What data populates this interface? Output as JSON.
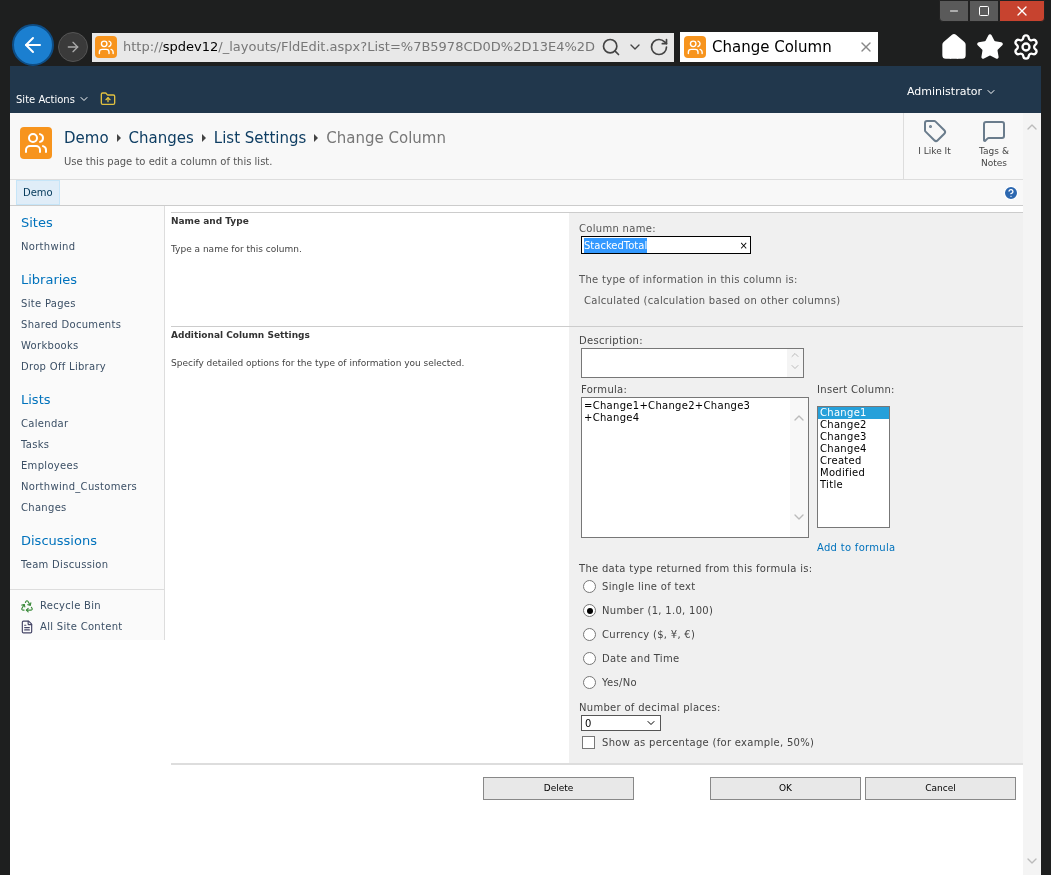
{
  "browser": {
    "url_host": "spdev12",
    "url_prefix": "http://",
    "url_rest": "/_layouts/FldEdit.aspx?List=%7B5978CD0D%2D13E4%2D",
    "tab_title": "Change Column"
  },
  "ribbon": {
    "site_actions": "Site Actions",
    "user": "Administrator"
  },
  "header": {
    "breadcrumb": [
      "Demo",
      "Changes",
      "List Settings",
      "Change Column"
    ],
    "description": "Use this page to edit a column of this list.",
    "actions": [
      {
        "label": "I Like It",
        "kind": "like"
      },
      {
        "label": "Tags & Notes",
        "kind": "tags"
      }
    ]
  },
  "top_nav": [
    {
      "label": "Demo",
      "selected": true
    }
  ],
  "sidebar": {
    "sections": [
      {
        "heading": "Sites",
        "items": [
          "Northwind"
        ]
      },
      {
        "heading": "Libraries",
        "items": [
          "Site Pages",
          "Shared Documents",
          "Workbooks",
          "Drop Off Library"
        ]
      },
      {
        "heading": "Lists",
        "items": [
          "Calendar",
          "Tasks",
          "Employees",
          "Northwind_Customers",
          "Changes"
        ]
      },
      {
        "heading": "Discussions",
        "items": [
          "Team Discussion"
        ]
      }
    ],
    "footer": [
      {
        "label": "Recycle Bin",
        "kind": "recycle"
      },
      {
        "label": "All Site Content",
        "kind": "content"
      }
    ]
  },
  "form": {
    "sections": [
      {
        "title": "Name and Type",
        "description": "Type a name for this column."
      },
      {
        "title": "Additional Column Settings",
        "description": "Specify detailed options for the type of information you selected."
      }
    ],
    "column_name": {
      "label": "Column name:",
      "value": "StackedTotal",
      "clear": "×"
    },
    "type_info": {
      "label": "The type of information in this column is:",
      "value": "Calculated (calculation based on other columns)"
    },
    "description": {
      "label": "Description:"
    },
    "formula": {
      "label": "Formula:",
      "lines": [
        "=Change1+Change2+Change3",
        "+Change4"
      ]
    },
    "insert_column": {
      "label": "Insert Column:",
      "link": "Add to formula",
      "items": [
        {
          "label": "Change1",
          "selected": true
        },
        {
          "label": "Change2",
          "selected": false
        },
        {
          "label": "Change3",
          "selected": false
        },
        {
          "label": "Change4",
          "selected": false
        },
        {
          "label": "Created",
          "selected": false
        },
        {
          "label": "Modified",
          "selected": false
        },
        {
          "label": "Title",
          "selected": false
        }
      ]
    },
    "data_type": {
      "label": "The data type returned from this formula is:",
      "options": [
        {
          "label": "Single line of text",
          "selected": false
        },
        {
          "label": "Number (1, 1.0, 100)",
          "selected": true
        },
        {
          "label": "Currency ($, ¥, €)",
          "selected": false
        },
        {
          "label": "Date and Time",
          "selected": false
        },
        {
          "label": "Yes/No",
          "selected": false
        }
      ]
    },
    "decimals": {
      "label": "Number of decimal places:",
      "value": "0"
    },
    "percentage": {
      "label": "Show as percentage (for example, 50%)",
      "checked": false
    }
  },
  "buttons": {
    "delete": "Delete",
    "ok": "OK",
    "cancel": "Cancel"
  }
}
